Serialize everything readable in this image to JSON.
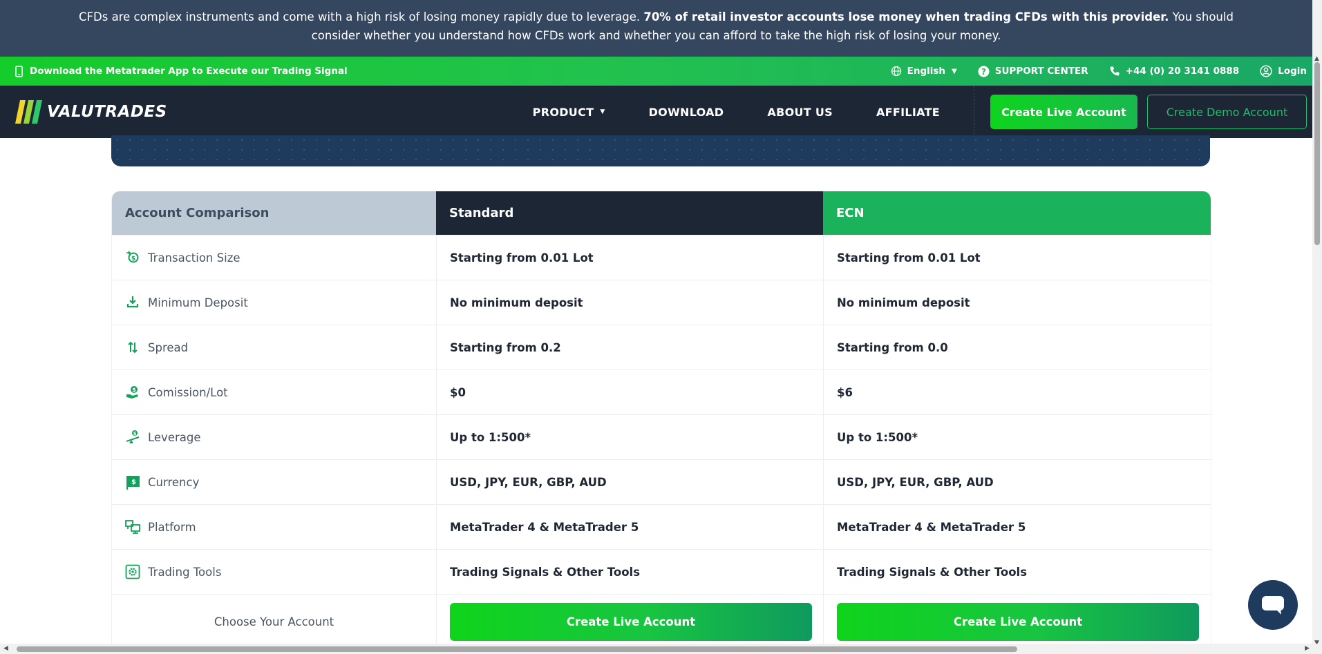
{
  "risk_banner": {
    "text_before": "CFDs are complex instruments and come with a high risk of losing money rapidly due to leverage. ",
    "text_bold": "70% of retail investor accounts lose money when trading CFDs with this provider.",
    "text_after": " You should consider whether you understand how CFDs work and whether you can afford to take the high risk of losing your money."
  },
  "promo_bar": {
    "download_text": "Download the Metatrader App to Execute our Trading Signal",
    "language": "English",
    "support": "SUPPORT CENTER",
    "phone": "+44 (0) 20 3141 0888",
    "login": "Login"
  },
  "header": {
    "logo_text": "VALUTRADES",
    "nav": [
      {
        "label": "PRODUCT",
        "has_caret": true
      },
      {
        "label": "DOWNLOAD"
      },
      {
        "label": "ABOUT US"
      },
      {
        "label": "AFFILIATE"
      }
    ],
    "create_live": "Create Live Account",
    "create_demo": "Create Demo Account"
  },
  "comparison": {
    "headers": [
      "Account Comparison",
      "Standard",
      "ECN"
    ],
    "rows": [
      {
        "icon": "transaction-size-icon",
        "label": "Transaction Size",
        "standard": "Starting from 0.01 Lot",
        "ecn": "Starting from 0.01 Lot"
      },
      {
        "icon": "deposit-icon",
        "label": "Minimum Deposit",
        "standard": "No minimum deposit",
        "ecn": "No minimum deposit"
      },
      {
        "icon": "spread-icon",
        "label": "Spread",
        "standard": "Starting from 0.2",
        "ecn": "Starting from 0.0"
      },
      {
        "icon": "commission-icon",
        "label": "Comission/Lot",
        "standard": "$0",
        "ecn": "$6"
      },
      {
        "icon": "leverage-icon",
        "label": "Leverage",
        "standard": "Up to 1:500*",
        "ecn": "Up to 1:500*"
      },
      {
        "icon": "currency-icon",
        "label": "Currency",
        "standard": "USD, JPY, EUR, GBP, AUD",
        "ecn": "USD, JPY, EUR, GBP, AUD"
      },
      {
        "icon": "platform-icon",
        "label": "Platform",
        "standard": "MetaTrader 4 & MetaTrader 5",
        "ecn": "MetaTrader 4 & MetaTrader 5"
      },
      {
        "icon": "trading-tools-icon",
        "label": "Trading Tools",
        "standard": "Trading Signals & Other Tools",
        "ecn": "Trading Signals & Other Tools"
      }
    ],
    "choose_label": "Choose Your Account",
    "standard_button": "Create Live Account",
    "ecn_button": "Create Live Account"
  },
  "colors": {
    "banner_bg": "#34475f",
    "header_bg": "#1c2634",
    "accent_green": "#1ab35c",
    "bright_green": "#0ed41e",
    "icon_green": "#12a35a"
  }
}
